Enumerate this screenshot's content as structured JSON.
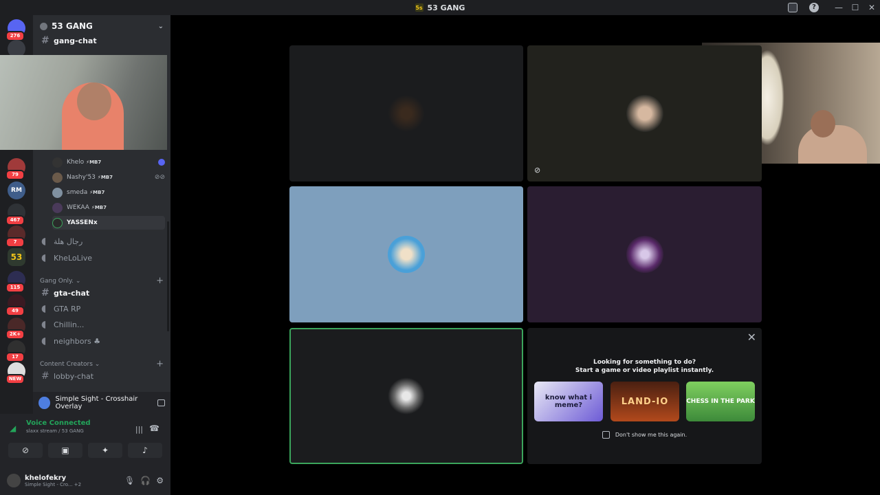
{
  "window": {
    "title": "53 GANG",
    "logo_text": "5s",
    "minimize": "—",
    "maximize": "☐",
    "close": "✕"
  },
  "rail": {
    "badges": [
      "276",
      "79",
      "467",
      "7",
      "115",
      "49",
      "2K+",
      "17",
      "NEW"
    ],
    "active_server_label": "53"
  },
  "server": {
    "name": "53 GANG",
    "chevron": "⌄"
  },
  "channels": {
    "top": [
      {
        "name": "gang-chat",
        "type": "text"
      },
      {
        "name": "رجال هلة",
        "type": "voice"
      },
      {
        "name": "KheLoLive",
        "type": "voice"
      }
    ],
    "voice_users": [
      {
        "name": "Khelo",
        "tag": "⚡MB7"
      },
      {
        "name": "Nashy'53",
        "tag": "⚡MB7"
      },
      {
        "name": "smeda",
        "tag": "⚡MB7"
      },
      {
        "name": "WEKAA",
        "tag": "⚡MB7"
      },
      {
        "name": "YASSENx",
        "tag": ""
      }
    ],
    "categories": [
      {
        "name": "Gang Only.",
        "chevron": "⌄",
        "plus": "+"
      },
      {
        "name": "Content Creators",
        "chevron": "⌄",
        "plus": "+"
      }
    ],
    "gang_only": [
      {
        "name": "gta-chat",
        "type": "text"
      },
      {
        "name": "GTA RP",
        "type": "voice"
      },
      {
        "name": "Chillin...",
        "type": "voice"
      },
      {
        "name": "neighbors ♣",
        "type": "voice"
      }
    ],
    "content_creators": [
      {
        "name": "lobby-chat",
        "type": "text"
      }
    ]
  },
  "overlay_bar": {
    "label": "Simple Sight - Crosshair Overlay"
  },
  "voice_panel": {
    "status": "Voice Connected",
    "location": "slaxx stream / 53 GANG"
  },
  "user_panel": {
    "username": "khelofekry",
    "status": "Simple Sight - Cro...",
    "extra": "+2"
  },
  "activities": {
    "title_line1": "Looking for something to do?",
    "title_line2": "Start a game or video playlist instantly.",
    "cards": [
      {
        "name": "know what i meme?"
      },
      {
        "name": "LAND-IO"
      },
      {
        "name": "CHESS IN THE PARK"
      }
    ],
    "dont_show": "Don't show me this again.",
    "close": "✕"
  },
  "colors": {
    "accent_green": "#3ba55c",
    "badge_red": "#f23f43",
    "sidebar": "#2b2d31",
    "rail": "#1e1f22"
  }
}
